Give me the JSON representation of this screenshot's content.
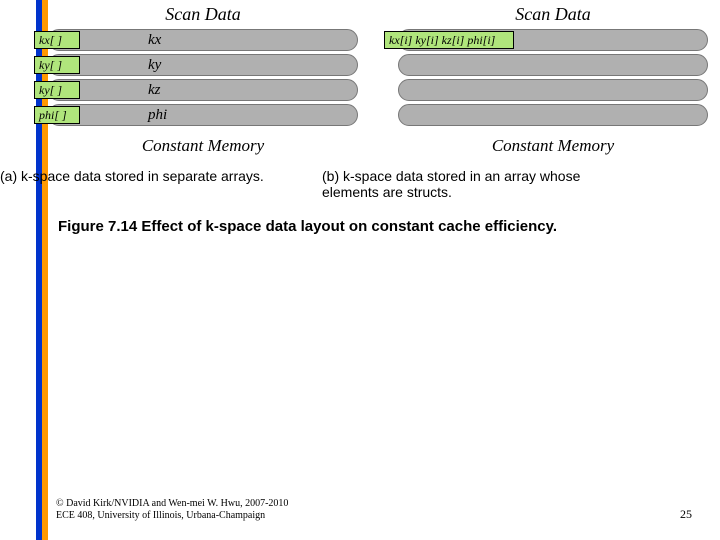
{
  "diagram_a": {
    "title": "Scan Data",
    "rows": [
      {
        "label": "kx[ ]",
        "inner": "kx"
      },
      {
        "label": "ky[ ]",
        "inner": "ky"
      },
      {
        "label": "ky[ ]",
        "inner": "kz"
      },
      {
        "label": "phi[ ]",
        "inner": "phi"
      }
    ],
    "footer": "Constant Memory"
  },
  "diagram_b": {
    "title": "Scan Data",
    "rows": [
      {
        "label": "kx[i] ky[i] kz[i] phi[i]"
      },
      {
        "label": ""
      },
      {
        "label": ""
      },
      {
        "label": ""
      }
    ],
    "footer": "Constant Memory"
  },
  "captions": {
    "a": "(a) k-space data stored in separate arrays.",
    "b": "(b) k-space data stored in an array whose elements are structs."
  },
  "figure_caption": "Figure 7.14 Effect of k-space data layout on constant cache efficiency.",
  "copyright": {
    "line1": "© David Kirk/NVIDIA and Wen-mei W. Hwu, 2007-2010",
    "line2": "ECE 408, University of Illinois, Urbana-Champaign"
  },
  "page_number": "25"
}
